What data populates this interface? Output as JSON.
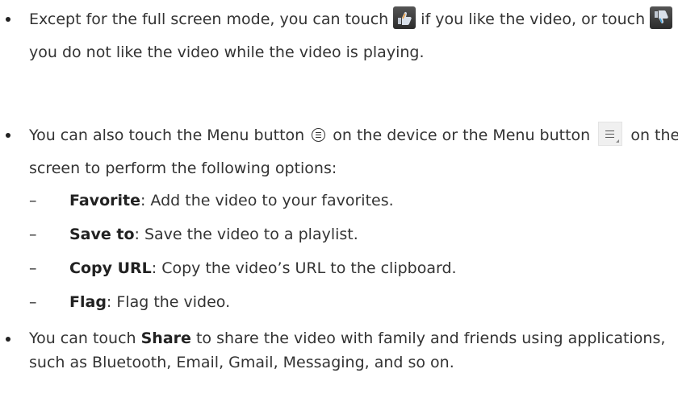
{
  "bullet1": {
    "text_a": "Except for the full screen mode, you can touch",
    "text_b": "if you like the video, or touch",
    "text_c": "if you do not like the video while the video is playing.",
    "icon_like": "thumbs-up-icon",
    "icon_dislike": "thumbs-down-icon"
  },
  "bullet2": {
    "text_a": "You can also touch the Menu button",
    "text_b": "on the device or the Menu button",
    "text_c": "on the screen to perform the following options:",
    "icon_device_menu": "device-menu-icon",
    "icon_screen_menu": "screen-menu-icon",
    "options": [
      {
        "dash": "–",
        "term": "Favorite",
        "desc": ": Add the video to your favorites."
      },
      {
        "dash": "–",
        "term": "Save to",
        "desc": ": Save the video to a playlist."
      },
      {
        "dash": "–",
        "term": "Copy URL",
        "desc": ": Copy the video’s URL to the clipboard."
      },
      {
        "dash": "–",
        "term": "Flag",
        "desc": ": Flag the video."
      }
    ]
  },
  "bullet3": {
    "text_a": "You can touch",
    "term": "Share",
    "text_b": "to share the video with family and friends using applications, such as Bluetooth, Email, Gmail, Messaging, and so on."
  }
}
